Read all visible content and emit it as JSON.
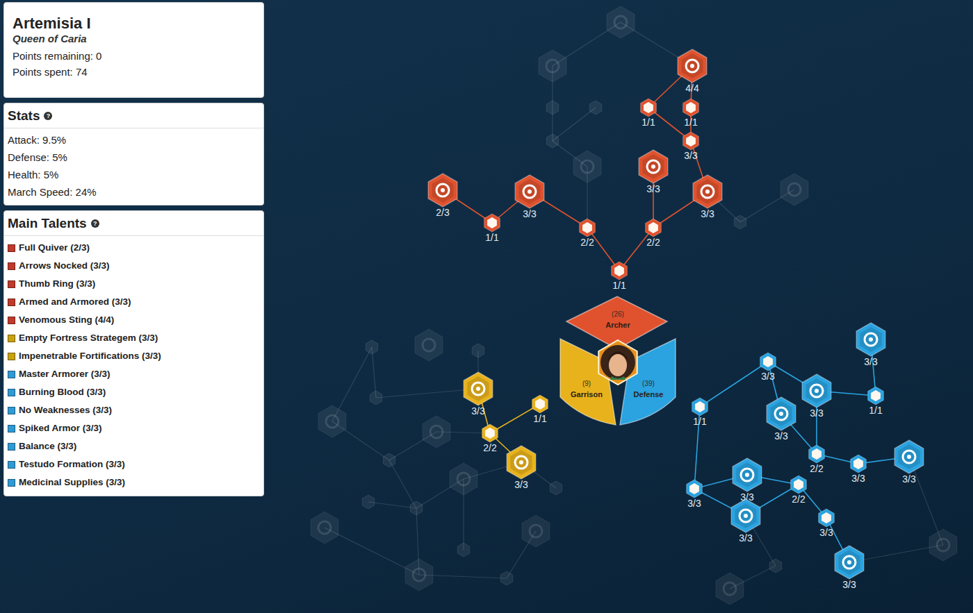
{
  "hero": {
    "name": "Artemisia I",
    "title": "Queen of Caria",
    "lines": [
      "Points remaining: 0",
      "Points spent: 74"
    ]
  },
  "stats": {
    "title": "Stats",
    "help": "?",
    "items": [
      "Attack: 9.5%",
      "Defense: 5%",
      "Health: 5%",
      "March Speed: 24%"
    ]
  },
  "main_talents": {
    "title": "Main Talents",
    "help": "?",
    "items": [
      {
        "label": "Full Quiver (2/3)",
        "color": "#c0392b"
      },
      {
        "label": "Arrows Nocked (3/3)",
        "color": "#c0392b"
      },
      {
        "label": "Thumb Ring (3/3)",
        "color": "#c0392b"
      },
      {
        "label": "Armed and Armored (3/3)",
        "color": "#c0392b"
      },
      {
        "label": "Venomous Sting (4/4)",
        "color": "#c0392b"
      },
      {
        "label": "Empty Fortress Strategem (3/3)",
        "color": "#c9a20e"
      },
      {
        "label": "Impenetrable Fortifications (3/3)",
        "color": "#c9a20e"
      },
      {
        "label": "Master Armorer (3/3)",
        "color": "#2e9ad6"
      },
      {
        "label": "Burning Blood (3/3)",
        "color": "#2e9ad6"
      },
      {
        "label": "No Weaknesses (3/3)",
        "color": "#2e9ad6"
      },
      {
        "label": "Spiked Armor (3/3)",
        "color": "#2e9ad6"
      },
      {
        "label": "Balance (3/3)",
        "color": "#2e9ad6"
      },
      {
        "label": "Testudo Formation (3/3)",
        "color": "#2e9ad6"
      },
      {
        "label": "Medicinal Supplies (3/3)",
        "color": "#2e9ad6"
      }
    ]
  },
  "branches": [
    {
      "id": "archer",
      "name": "Archer",
      "points": "(26)",
      "color": "#e0522e"
    },
    {
      "id": "garrison",
      "name": "Garrison",
      "points": "(9)",
      "color": "#e8b21c"
    },
    {
      "id": "defense",
      "name": "Defense",
      "points": "(39)",
      "color": "#2aa3e0"
    }
  ],
  "nodes": [
    {
      "branch": "archer",
      "kind": "big",
      "active": true,
      "label": "4/4"
    },
    {
      "branch": "archer",
      "kind": "small",
      "active": true,
      "label": "1/1"
    },
    {
      "branch": "archer",
      "kind": "small",
      "active": true,
      "label": "1/1"
    },
    {
      "branch": "archer",
      "kind": "small",
      "active": true,
      "label": "3/3"
    },
    {
      "branch": "archer",
      "kind": "big",
      "active": true,
      "label": "3/3"
    },
    {
      "branch": "archer",
      "kind": "big",
      "active": true,
      "label": "3/3"
    },
    {
      "branch": "archer",
      "kind": "big",
      "active": true,
      "label": "2/3"
    },
    {
      "branch": "archer",
      "kind": "small",
      "active": true,
      "label": "1/1"
    },
    {
      "branch": "archer",
      "kind": "big",
      "active": true,
      "label": "3/3"
    },
    {
      "branch": "archer",
      "kind": "small",
      "active": true,
      "label": "2/2"
    },
    {
      "branch": "archer",
      "kind": "small",
      "active": true,
      "label": "2/2"
    },
    {
      "branch": "archer",
      "kind": "small",
      "active": true,
      "label": "1/1"
    },
    {
      "branch": "archer",
      "kind": "big",
      "active": false
    },
    {
      "branch": "archer",
      "kind": "big",
      "active": false
    },
    {
      "branch": "archer",
      "kind": "small",
      "active": false
    },
    {
      "branch": "archer",
      "kind": "small",
      "active": false
    },
    {
      "branch": "archer",
      "kind": "small",
      "active": false
    },
    {
      "branch": "archer",
      "kind": "big",
      "active": false
    },
    {
      "branch": "archer",
      "kind": "big",
      "active": false
    },
    {
      "branch": "archer",
      "kind": "small",
      "active": false
    },
    {
      "branch": "garrison",
      "kind": "big",
      "active": true,
      "label": "3/3"
    },
    {
      "branch": "garrison",
      "kind": "small",
      "active": true,
      "label": "1/1"
    },
    {
      "branch": "garrison",
      "kind": "small",
      "active": true,
      "label": "2/2"
    },
    {
      "branch": "garrison",
      "kind": "big",
      "active": true,
      "label": "3/3"
    },
    {
      "branch": "garrison",
      "kind": "small",
      "active": false
    },
    {
      "branch": "garrison",
      "kind": "big",
      "active": false
    },
    {
      "branch": "garrison",
      "kind": "small",
      "active": false
    },
    {
      "branch": "garrison",
      "kind": "small",
      "active": false
    },
    {
      "branch": "garrison",
      "kind": "big",
      "active": false
    },
    {
      "branch": "garrison",
      "kind": "big",
      "active": false
    },
    {
      "branch": "garrison",
      "kind": "small",
      "active": false
    },
    {
      "branch": "garrison",
      "kind": "big",
      "active": false
    },
    {
      "branch": "garrison",
      "kind": "small",
      "active": false
    },
    {
      "branch": "garrison",
      "kind": "small",
      "active": false
    },
    {
      "branch": "garrison",
      "kind": "small",
      "active": false
    },
    {
      "branch": "garrison",
      "kind": "big",
      "active": false
    },
    {
      "branch": "garrison",
      "kind": "big",
      "active": false
    },
    {
      "branch": "garrison",
      "kind": "small",
      "active": false
    },
    {
      "branch": "garrison",
      "kind": "big",
      "active": false
    },
    {
      "branch": "garrison",
      "kind": "small",
      "active": false
    },
    {
      "branch": "defense",
      "kind": "big",
      "active": true,
      "label": "3/3"
    },
    {
      "branch": "defense",
      "kind": "small",
      "active": true,
      "label": "3/3"
    },
    {
      "branch": "defense",
      "kind": "big",
      "active": true,
      "label": "3/3"
    },
    {
      "branch": "defense",
      "kind": "small",
      "active": true,
      "label": "1/1"
    },
    {
      "branch": "defense",
      "kind": "small",
      "active": true,
      "label": "1/1"
    },
    {
      "branch": "defense",
      "kind": "big",
      "active": true,
      "label": "3/3"
    },
    {
      "branch": "defense",
      "kind": "small",
      "active": true,
      "label": "2/2"
    },
    {
      "branch": "defense",
      "kind": "small",
      "active": true,
      "label": "3/3"
    },
    {
      "branch": "defense",
      "kind": "big",
      "active": true,
      "label": "3/3"
    },
    {
      "branch": "defense",
      "kind": "big",
      "active": true,
      "label": "3/3"
    },
    {
      "branch": "defense",
      "kind": "small",
      "active": true,
      "label": "3/3"
    },
    {
      "branch": "defense",
      "kind": "small",
      "active": true,
      "label": "2/2"
    },
    {
      "branch": "defense",
      "kind": "big",
      "active": true,
      "label": "3/3"
    },
    {
      "branch": "defense",
      "kind": "small",
      "active": true,
      "label": "3/3"
    },
    {
      "branch": "defense",
      "kind": "big",
      "active": true,
      "label": "3/3"
    },
    {
      "branch": "defense",
      "kind": "small",
      "active": false
    },
    {
      "branch": "defense",
      "kind": "big",
      "active": false
    },
    {
      "branch": "defense",
      "kind": "big",
      "active": false
    }
  ]
}
